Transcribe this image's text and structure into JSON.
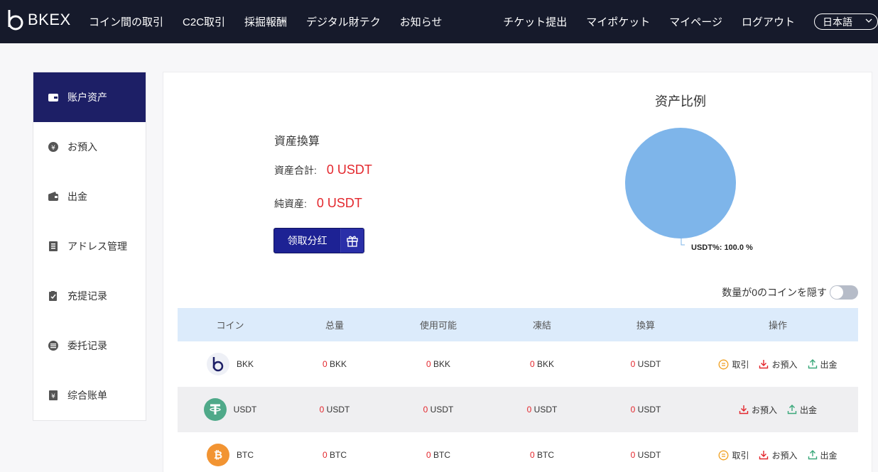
{
  "brand": {
    "name": "BKEX"
  },
  "nav": {
    "left": [
      "コイン間の取引",
      "C2C取引",
      "採掘報酬",
      "デジタル財テク",
      "お知らせ"
    ],
    "right": [
      "チケット提出",
      "マイポケット",
      "マイページ",
      "ログアウト"
    ],
    "language": "日本語"
  },
  "sidebar": {
    "items": [
      {
        "label": "账户资产",
        "icon": "wallet-card-icon",
        "active": true
      },
      {
        "label": "お預入",
        "icon": "yen-circle-icon"
      },
      {
        "label": "出金",
        "icon": "wallet-icon"
      },
      {
        "label": "アドレス管理",
        "icon": "address-book-icon"
      },
      {
        "label": "充提记录",
        "icon": "record-icon"
      },
      {
        "label": "委托记录",
        "icon": "list-icon"
      },
      {
        "label": "综合账单",
        "icon": "bill-icon"
      }
    ]
  },
  "conversion": {
    "title": "資産換算",
    "total_label": "資産合計:",
    "total_value": "0 USDT",
    "net_label": "純資産:",
    "net_value": "0 USDT",
    "dividend_button": "领取分红"
  },
  "chart_data": {
    "type": "pie",
    "title": "资产比例",
    "slices": [
      {
        "label": "USDT",
        "value": 100.0
      }
    ],
    "label_text": "USDT%: 100.0 %",
    "colors": [
      "#7eb5ea"
    ]
  },
  "hide_zero": {
    "label": "数量が0のコインを隠す",
    "on": false
  },
  "table": {
    "headers": [
      "コイン",
      "总量",
      "使用可能",
      "凍結",
      "換算",
      "操作"
    ],
    "rows": [
      {
        "coin": "BKK",
        "total": "0",
        "total_unit": "BKK",
        "available": "0",
        "available_unit": "BKK",
        "frozen": "0",
        "frozen_unit": "BKK",
        "converted": "0",
        "converted_unit": "USDT",
        "ops": [
          "取引",
          "お預入",
          "出金"
        ]
      },
      {
        "coin": "USDT",
        "total": "0",
        "total_unit": "USDT",
        "available": "0",
        "available_unit": "USDT",
        "frozen": "0",
        "frozen_unit": "USDT",
        "converted": "0",
        "converted_unit": "USDT",
        "ops": [
          "お預入",
          "出金"
        ]
      },
      {
        "coin": "BTC",
        "total": "0",
        "total_unit": "BTC",
        "available": "0",
        "available_unit": "BTC",
        "frozen": "0",
        "frozen_unit": "BTC",
        "converted": "0",
        "converted_unit": "USDT",
        "ops": [
          "取引",
          "お預入",
          "出金"
        ]
      }
    ]
  },
  "colors": {
    "nav_bg": "#161a2b",
    "accent": "#1d1f66",
    "negative": "#e3262c",
    "header_bg": "#dcebfb"
  }
}
